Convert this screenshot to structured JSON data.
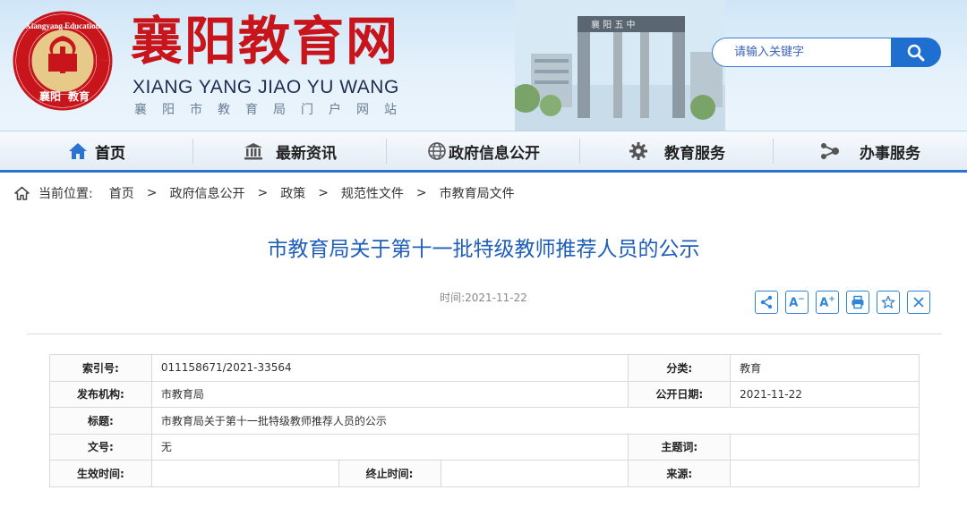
{
  "header": {
    "site_title": "襄阳教育网",
    "site_pinyin": "XIANG YANG JIAO YU WANG",
    "site_subtitle": "襄阳市教育局门户网站",
    "logo_text": "Xiangyang Education",
    "search": {
      "placeholder": "请输入关键字",
      "icon": "search-icon"
    }
  },
  "nav": {
    "items": [
      {
        "label": "首页",
        "icon": "home-icon"
      },
      {
        "label": "最新资讯",
        "icon": "building-icon"
      },
      {
        "label": "政府信息公开",
        "icon": "globe-icon"
      },
      {
        "label": "教育服务",
        "icon": "gear-icon"
      },
      {
        "label": "办事服务",
        "icon": "share-icon"
      }
    ]
  },
  "breadcrumb": {
    "label": "当前位置:",
    "items": [
      "首页",
      "政府信息公开",
      "政策",
      "规范性文件",
      "市教育局文件"
    ],
    "separator": ">"
  },
  "article": {
    "title": "市教育局关于第十一批特级教师推荐人员的公示",
    "date": "时间:2021-11-22",
    "tools": [
      "share-icon",
      "font-decrease-icon",
      "font-increase-icon",
      "print-icon",
      "star-icon",
      "close-icon"
    ]
  },
  "info_table": {
    "index_label": "索引号:",
    "index_value": "011158671/2021-33564",
    "category_label": "分类:",
    "category_value": "教育",
    "publisher_label": "发布机构:",
    "publisher_value": "市教育局",
    "open_date_label": "公开日期:",
    "open_date_value": "2021-11-22",
    "title_label": "标题:",
    "title_value": "市教育局关于第十一批特级教师推荐人员的公示",
    "doc_no_label": "文号:",
    "doc_no_value": "无",
    "keywords_label": "主题词:",
    "keywords_value": "",
    "effective_label": "生效时间:",
    "effective_value": "",
    "end_label": "终止时间:",
    "end_value": "",
    "source_label": "来源:",
    "source_value": ""
  },
  "colors": {
    "brand_red": "#c8151b",
    "nav_blue": "#2a73d2",
    "title_blue": "#1f5fb9"
  }
}
